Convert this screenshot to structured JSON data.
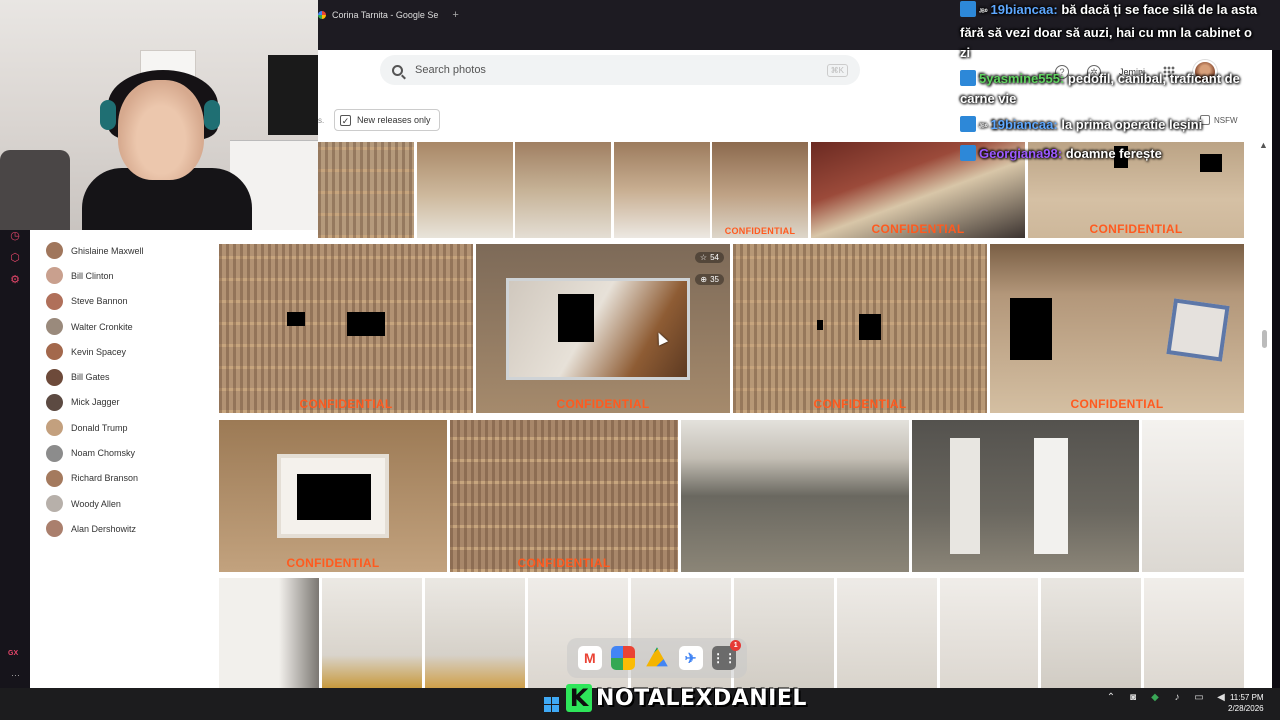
{
  "browser": {
    "tab_title": "Corina Tarnita - Google Se",
    "new_tab_symbol": "+"
  },
  "header": {
    "search_placeholder": "Search photos",
    "search_shortcut": "⌘K",
    "account_label": "Jemini"
  },
  "filters": {
    "truncated_prefix": "s.",
    "new_releases_label": "New releases only",
    "new_releases_checked": "✓",
    "nsfw_label": "NSFW"
  },
  "people": [
    {
      "name": "Ghislaine Maxwell",
      "color": "#a0765c"
    },
    {
      "name": "Bill Clinton",
      "color": "#c9a08e"
    },
    {
      "name": "Steve Bannon",
      "color": "#b0705a"
    },
    {
      "name": "Walter Cronkite",
      "color": "#9a8a7c"
    },
    {
      "name": "Kevin Spacey",
      "color": "#a3684c"
    },
    {
      "name": "Bill Gates",
      "color": "#6d4a3a"
    },
    {
      "name": "Mick Jagger",
      "color": "#5c4a42"
    },
    {
      "name": "Donald Trump",
      "color": "#c3a07e"
    },
    {
      "name": "Noam Chomsky",
      "color": "#8c8c8c"
    },
    {
      "name": "Richard Branson",
      "color": "#a47a5e"
    },
    {
      "name": "Woody Allen",
      "color": "#b7b0aa"
    },
    {
      "name": "Alan Dershowitz",
      "color": "#aa7f6d"
    }
  ],
  "photos": {
    "confidential_label": "CONFIDENTIAL",
    "featured_stars": "54",
    "featured_count": "35"
  },
  "dock": {
    "apps": [
      "gmail-icon",
      "photos-icon",
      "drive-icon",
      "flights-icon",
      "apps-icon"
    ],
    "apps_badge": "1"
  },
  "chat": [
    {
      "user": "19biancaa:",
      "user_color": "#5ea8ff",
      "prefix": "ᴶᴮ⁰",
      "text": "bă dacă ți se face silă de la asta fără să vezi doar să auzi, hai cu mn la cabinet o zi"
    },
    {
      "user": "5yasmine555:",
      "user_color": "#5fd35f",
      "prefix": "",
      "text": "pedofil, canibal, traficant de carne vie"
    },
    {
      "user": "19biancaa:",
      "user_color": "#5ea8ff",
      "prefix": "ᴶᴮ⁰",
      "text": "la prima operatie leșini"
    },
    {
      "user": "Georgiana98:",
      "user_color": "#9b59ff",
      "prefix": "",
      "text": "doamne ferește"
    }
  ],
  "stream": {
    "channel_badge": "K",
    "channel_name": "NOTALEXDANIEL"
  },
  "leftbar": {
    "label": "GX",
    "more": "···"
  },
  "taskbar": {
    "time": "11:57 PM",
    "date": "2/28/2026"
  }
}
